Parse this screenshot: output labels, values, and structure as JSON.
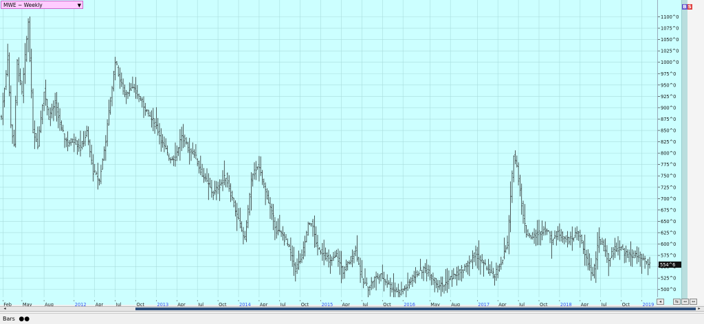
{
  "title_label": "MWE ~ Weekly",
  "title_dropdown": "▼",
  "bs_icon": {
    "b": "B",
    "s": "S",
    "b_color": "#6a5acd",
    "s_color": "#e04040"
  },
  "current_price_label": "554^6",
  "nav_buttons": [
    "◂",
    "⇆",
    "↔",
    "↔"
  ],
  "scroll": {
    "left": "◂",
    "right": "▸"
  },
  "toolbar": {
    "bars_label": "Bars",
    "bars_glyph": "●●"
  },
  "colors": {
    "background": "#ccffff",
    "bars": "#2a2a2a",
    "grid": "#a9dcdc",
    "year_label": "#3355ee"
  },
  "chart_data": {
    "type": "bar",
    "style": "ohlc-weekly",
    "title": "MWE ~ Weekly",
    "x_axis_labels": [
      {
        "label": "Feb",
        "year": false
      },
      {
        "label": "May",
        "year": false
      },
      {
        "label": "Aug",
        "year": false
      },
      {
        "label": "2012",
        "year": true
      },
      {
        "label": "Apr",
        "year": false
      },
      {
        "label": "Jul",
        "year": false
      },
      {
        "label": "Oct",
        "year": false
      },
      {
        "label": "2013",
        "year": true
      },
      {
        "label": "Apr",
        "year": false
      },
      {
        "label": "Jul",
        "year": false
      },
      {
        "label": "Oct",
        "year": false
      },
      {
        "label": "2014",
        "year": true
      },
      {
        "label": "Apr",
        "year": false
      },
      {
        "label": "Jul",
        "year": false
      },
      {
        "label": "Oct",
        "year": false
      },
      {
        "label": "2015",
        "year": true
      },
      {
        "label": "Apr",
        "year": false
      },
      {
        "label": "Jul",
        "year": false
      },
      {
        "label": "Oct",
        "year": false
      },
      {
        "label": "2016",
        "year": true
      },
      {
        "label": "May",
        "year": false
      },
      {
        "label": "Aug",
        "year": false
      },
      {
        "label": "2017",
        "year": true
      },
      {
        "label": "Apr",
        "year": false
      },
      {
        "label": "Jul",
        "year": false
      },
      {
        "label": "Oct",
        "year": false
      },
      {
        "label": "2018",
        "year": true
      },
      {
        "label": "Apr",
        "year": false
      },
      {
        "label": "Jul",
        "year": false
      },
      {
        "label": "Oct",
        "year": false
      },
      {
        "label": "2019",
        "year": true
      }
    ],
    "x_label_index": [
      1,
      13,
      27,
      46,
      59,
      72,
      85,
      98,
      111,
      124,
      137,
      150,
      163,
      176,
      189,
      202,
      215,
      228,
      241,
      254,
      271,
      284,
      301,
      314,
      327,
      340,
      353,
      366,
      379,
      392,
      405
    ],
    "y_ticks": [
      "1100^0",
      "1075^0",
      "1050^0",
      "1025^0",
      "1000^0",
      "975^0",
      "950^0",
      "925^0",
      "900^0",
      "875^0",
      "850^0",
      "825^0",
      "800^0",
      "775^0",
      "750^0",
      "725^0",
      "700^0",
      "675^0",
      "650^0",
      "625^0",
      "600^0",
      "575^0",
      "550^0",
      "525^0",
      "500^0"
    ],
    "y_tick_values": [
      1100,
      1075,
      1050,
      1025,
      1000,
      975,
      950,
      925,
      900,
      875,
      850,
      825,
      800,
      775,
      750,
      725,
      700,
      675,
      650,
      625,
      600,
      575,
      550,
      525,
      500
    ],
    "ylim": [
      483,
      1137
    ],
    "grid": true,
    "last_price": 554.75,
    "anchors": [
      [
        0,
        880
      ],
      [
        4,
        1010
      ],
      [
        6,
        860
      ],
      [
        8,
        820
      ],
      [
        10,
        1000
      ],
      [
        13,
        930
      ],
      [
        17,
        1090
      ],
      [
        20,
        850
      ],
      [
        23,
        820
      ],
      [
        27,
        940
      ],
      [
        30,
        880
      ],
      [
        34,
        910
      ],
      [
        38,
        850
      ],
      [
        42,
        820
      ],
      [
        46,
        830
      ],
      [
        50,
        810
      ],
      [
        54,
        845
      ],
      [
        58,
        760
      ],
      [
        62,
        740
      ],
      [
        66,
        830
      ],
      [
        72,
        1005
      ],
      [
        75,
        960
      ],
      [
        78,
        930
      ],
      [
        82,
        945
      ],
      [
        86,
        930
      ],
      [
        90,
        905
      ],
      [
        94,
        880
      ],
      [
        98,
        860
      ],
      [
        102,
        820
      ],
      [
        106,
        790
      ],
      [
        110,
        790
      ],
      [
        114,
        840
      ],
      [
        118,
        810
      ],
      [
        122,
        800
      ],
      [
        126,
        760
      ],
      [
        130,
        735
      ],
      [
        134,
        710
      ],
      [
        138,
        730
      ],
      [
        142,
        750
      ],
      [
        146,
        700
      ],
      [
        150,
        650
      ],
      [
        154,
        610
      ],
      [
        158,
        740
      ],
      [
        162,
        775
      ],
      [
        166,
        730
      ],
      [
        170,
        680
      ],
      [
        174,
        630
      ],
      [
        178,
        620
      ],
      [
        182,
        590
      ],
      [
        186,
        545
      ],
      [
        190,
        570
      ],
      [
        194,
        640
      ],
      [
        196,
        650
      ],
      [
        200,
        590
      ],
      [
        204,
        580
      ],
      [
        208,
        560
      ],
      [
        212,
        575
      ],
      [
        216,
        540
      ],
      [
        220,
        560
      ],
      [
        224,
        590
      ],
      [
        228,
        520
      ],
      [
        232,
        505
      ],
      [
        236,
        525
      ],
      [
        240,
        530
      ],
      [
        244,
        515
      ],
      [
        248,
        500
      ],
      [
        252,
        495
      ],
      [
        256,
        505
      ],
      [
        260,
        525
      ],
      [
        264,
        540
      ],
      [
        268,
        545
      ],
      [
        272,
        530
      ],
      [
        276,
        510
      ],
      [
        280,
        510
      ],
      [
        284,
        525
      ],
      [
        288,
        535
      ],
      [
        292,
        545
      ],
      [
        296,
        560
      ],
      [
        300,
        580
      ],
      [
        304,
        560
      ],
      [
        308,
        540
      ],
      [
        312,
        530
      ],
      [
        316,
        560
      ],
      [
        320,
        600
      ],
      [
        322,
        700
      ],
      [
        324,
        800
      ],
      [
        326,
        770
      ],
      [
        328,
        720
      ],
      [
        330,
        660
      ],
      [
        332,
        625
      ],
      [
        336,
        615
      ],
      [
        340,
        625
      ],
      [
        344,
        635
      ],
      [
        348,
        610
      ],
      [
        352,
        625
      ],
      [
        356,
        615
      ],
      [
        360,
        610
      ],
      [
        364,
        625
      ],
      [
        366,
        620
      ],
      [
        368,
        585
      ],
      [
        372,
        550
      ],
      [
        374,
        530
      ],
      [
        376,
        570
      ],
      [
        378,
        610
      ],
      [
        380,
        600
      ],
      [
        384,
        565
      ],
      [
        388,
        590
      ],
      [
        392,
        590
      ],
      [
        396,
        575
      ],
      [
        400,
        575
      ],
      [
        404,
        570
      ],
      [
        408,
        560
      ],
      [
        410,
        554.75
      ]
    ]
  }
}
